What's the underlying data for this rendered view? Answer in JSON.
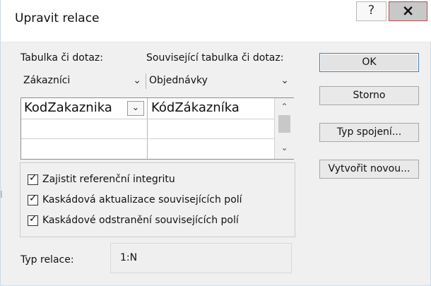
{
  "window": {
    "title": "Upravit relace",
    "help_glyph": "?",
    "close_glyph": "×"
  },
  "form": {
    "table_label": "Tabulka či dotaz:",
    "related_label": "Související tabulka či dotaz:",
    "table_value": "Zákazníci",
    "related_value": "Objednávky",
    "grid": {
      "left_value": "KodZakaznika",
      "right_value": "KódZákazníka"
    },
    "checkboxes": [
      {
        "label": "Zajistit referenční integritu",
        "checked": true
      },
      {
        "label": "Kaskádová aktualizace souvisejících polí",
        "checked": true
      },
      {
        "label": "Kaskádové odstranění souvisejících polí",
        "checked": true
      }
    ],
    "relation_type_label": "Typ relace:",
    "relation_type_value": "1:N"
  },
  "buttons": {
    "ok": "OK",
    "cancel": "Storno",
    "join_type": "Typ spojení...",
    "create_new": "Vytvořit novou..."
  },
  "icons": {
    "chevron_down": "chevron-down-icon",
    "help": "help-icon",
    "close": "close-icon"
  },
  "colors": {
    "default_button_border": "#3c7fb1",
    "background": "#f0f0f0"
  }
}
